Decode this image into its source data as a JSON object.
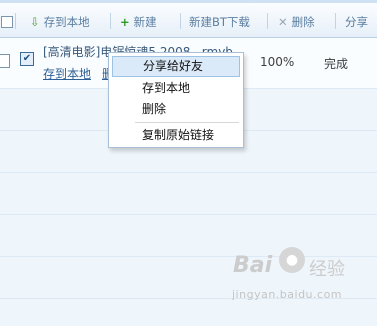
{
  "toolbar": {
    "save_local": "存到本地",
    "new": "新建",
    "new_bt": "新建BT下载",
    "delete": "删除",
    "share": "分享"
  },
  "task": {
    "name": "[高清电影]电锯惊魂5.2008.  .rmvb",
    "action_save": "存到本地",
    "action_more": "删",
    "progress": "100%",
    "status": "完成"
  },
  "context_menu": {
    "items": [
      "分享给好友",
      "存到本地",
      "删除",
      "复制原始链接"
    ]
  },
  "watermark": {
    "logo": "Bai",
    "logo_suffix": "经验",
    "url": "jingyan.baidu.com"
  },
  "icons": {
    "download": "download-arrow-icon",
    "plus": "plus-icon",
    "delete": "x-icon"
  },
  "colors": {
    "toolbar_text": "#5a7ea1",
    "link": "#2d5e95",
    "menu_highlight": "#dbeaf9"
  }
}
